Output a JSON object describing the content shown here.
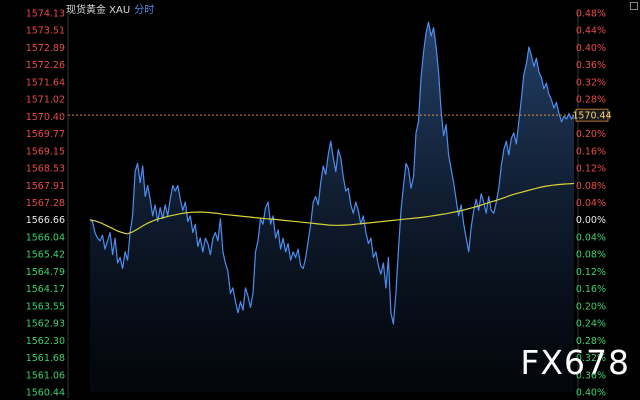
{
  "header": {
    "title": "现货黄金 XAU",
    "subtitle": "分时"
  },
  "watermark": "FX678",
  "icons": {
    "window": "window-toggle-icon"
  },
  "colors": {
    "background": "#000000",
    "price_up": "#e84a4a",
    "price_down": "#3bd16e",
    "neutral": "#e8e8e8",
    "price_line": "#4c8ff0",
    "avg_line": "#d8d23a",
    "ref_line": "#d98a3a"
  },
  "chart_data": {
    "type": "line",
    "title": "现货黄金 XAU",
    "subtitle": "分时",
    "y_left_ticks": [
      "1574.13",
      "1573.51",
      "1572.89",
      "1572.26",
      "1571.64",
      "1571.02",
      "1570.40",
      "1569.77",
      "1569.15",
      "1568.53",
      "1567.91",
      "1567.28",
      "1566.66",
      "1566.04",
      "1565.42",
      "1564.79",
      "1564.17",
      "1563.55",
      "1562.93",
      "1562.30",
      "1561.68",
      "1561.06",
      "1560.44"
    ],
    "y_right_ticks": [
      "0.48%",
      "0.44%",
      "0.40%",
      "0.36%",
      "0.32%",
      "0.28%",
      "0.24%",
      "0.20%",
      "0.16%",
      "0.12%",
      "0.08%",
      "0.04%",
      "0.00%",
      "0.04%",
      "0.08%",
      "0.12%",
      "0.16%",
      "0.20%",
      "0.24%",
      "0.28%",
      "0.32%",
      "0.36%",
      "0.40%"
    ],
    "ylim": [
      1560.44,
      1574.13
    ],
    "prev_close": 1566.66,
    "current_price": 1570.44,
    "current_price_label": "1570.44",
    "x_range": [
      0,
      190
    ],
    "series": [
      {
        "values": [
          1566.66,
          1566.6,
          1566.2,
          1566.0,
          1565.9,
          1566.1,
          1565.6,
          1565.9,
          1566.2,
          1565.4,
          1566.0,
          1565.1,
          1565.3,
          1564.9,
          1565.5,
          1565.2,
          1566.2,
          1566.8,
          1568.4,
          1568.7,
          1568.0,
          1568.6,
          1567.5,
          1567.9,
          1567.4,
          1566.8,
          1567.2,
          1566.6,
          1567.1,
          1566.7,
          1567.2,
          1566.8,
          1567.4,
          1567.9,
          1567.7,
          1567.9,
          1567.4,
          1567.0,
          1567.3,
          1566.6,
          1566.8,
          1566.2,
          1566.5,
          1565.7,
          1566.0,
          1565.5,
          1566.0,
          1565.8,
          1565.4,
          1566.0,
          1566.2,
          1565.9,
          1566.7,
          1565.5,
          1565.1,
          1564.8,
          1564.0,
          1564.2,
          1563.7,
          1563.3,
          1563.7,
          1563.4,
          1564.2,
          1563.9,
          1563.5,
          1564.0,
          1565.5,
          1565.9,
          1566.7,
          1566.5,
          1567.1,
          1567.3,
          1566.5,
          1566.8,
          1566.0,
          1566.3,
          1565.6,
          1566.0,
          1565.5,
          1565.8,
          1565.2,
          1565.5,
          1565.3,
          1565.6,
          1565.0,
          1564.9,
          1565.3,
          1565.9,
          1566.5,
          1567.3,
          1567.5,
          1567.2,
          1568.0,
          1568.6,
          1568.3,
          1569.0,
          1569.5,
          1568.9,
          1568.4,
          1569.2,
          1568.9,
          1568.2,
          1567.7,
          1567.8,
          1567.2,
          1566.9,
          1567.3,
          1567.0,
          1566.5,
          1566.8,
          1566.2,
          1565.8,
          1566.0,
          1565.3,
          1565.5,
          1565.0,
          1564.7,
          1565.1,
          1564.2,
          1565.3,
          1563.3,
          1562.9,
          1564.0,
          1565.6,
          1567.0,
          1567.9,
          1568.7,
          1568.5,
          1567.8,
          1568.2,
          1569.8,
          1570.2,
          1571.8,
          1572.7,
          1573.4,
          1573.8,
          1573.3,
          1573.6,
          1572.9,
          1572.0,
          1570.6,
          1569.7,
          1570.1,
          1569.0,
          1568.5,
          1568.0,
          1567.4,
          1566.8,
          1567.2,
          1566.5,
          1566.0,
          1565.5,
          1566.4,
          1567.0,
          1567.4,
          1567.0,
          1567.6,
          1567.3,
          1566.9,
          1567.5,
          1567.0,
          1566.9,
          1567.3,
          1567.8,
          1568.6,
          1569.2,
          1569.5,
          1569.0,
          1569.6,
          1569.8,
          1569.4,
          1570.2,
          1571.0,
          1571.9,
          1572.3,
          1572.9,
          1572.6,
          1572.2,
          1572.5,
          1572.0,
          1571.8,
          1571.4,
          1571.6,
          1571.2,
          1571.0,
          1570.7,
          1570.9,
          1570.5,
          1570.2,
          1570.4,
          1570.3,
          1570.5,
          1570.3,
          1570.44
        ]
      },
      {
        "values": [
          1566.66,
          1566.62,
          1566.55,
          1566.46,
          1566.37,
          1566.27,
          1566.2,
          1566.15,
          1566.22,
          1566.33,
          1566.45,
          1566.55,
          1566.63,
          1566.7,
          1566.75,
          1566.8,
          1566.84,
          1566.88,
          1566.91,
          1566.93,
          1566.94,
          1566.94,
          1566.93,
          1566.91,
          1566.89,
          1566.86,
          1566.84,
          1566.82,
          1566.8,
          1566.78,
          1566.76,
          1566.74,
          1566.72,
          1566.7,
          1566.69,
          1566.67,
          1566.65,
          1566.63,
          1566.61,
          1566.59,
          1566.57,
          1566.55,
          1566.53,
          1566.51,
          1566.49,
          1566.47,
          1566.46,
          1566.46,
          1566.47,
          1566.48,
          1566.5,
          1566.52,
          1566.54,
          1566.56,
          1566.58,
          1566.6,
          1566.62,
          1566.64,
          1566.66,
          1566.68,
          1566.7,
          1566.72,
          1566.74,
          1566.76,
          1566.79,
          1566.82,
          1566.85,
          1566.88,
          1566.92,
          1566.96,
          1567.0,
          1567.05,
          1567.1,
          1567.16,
          1567.22,
          1567.28,
          1567.34,
          1567.4,
          1567.47,
          1567.54,
          1567.6,
          1567.65,
          1567.7,
          1567.75,
          1567.8,
          1567.85,
          1567.88,
          1567.91,
          1567.93,
          1567.95,
          1567.96,
          1567.97
        ]
      }
    ]
  }
}
